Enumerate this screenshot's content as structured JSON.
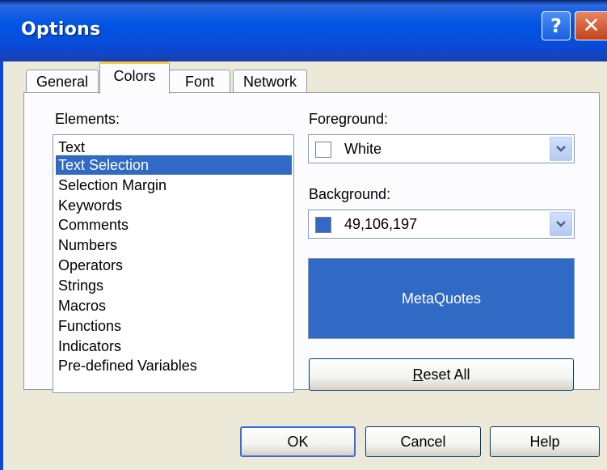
{
  "window": {
    "title": "Options"
  },
  "titlebar": {
    "help_glyph": "?",
    "close_glyph": "✕"
  },
  "tabs": [
    {
      "label": "General"
    },
    {
      "label": "Colors",
      "active": true
    },
    {
      "label": "Font"
    },
    {
      "label": "Network"
    }
  ],
  "elements": {
    "label": "Elements:",
    "items": [
      "Text",
      "Text Selection",
      "Selection Margin",
      "Keywords",
      "Comments",
      "Numbers",
      "Operators",
      "Strings",
      "Macros",
      "Functions",
      "Indicators",
      "Pre-defined Variables"
    ],
    "selected_index": 1
  },
  "foreground": {
    "label": "Foreground:",
    "value": "White",
    "color": "#ffffff"
  },
  "background": {
    "label": "Background:",
    "value": "49,106,197",
    "color": "#316ac5"
  },
  "preview": {
    "text": "MetaQuotes",
    "text_color": "#ffffff",
    "bg_color": "#316ac5"
  },
  "buttons": {
    "reset_first": "R",
    "reset_rest": "eset All",
    "ok": "OK",
    "cancel": "Cancel",
    "help": "Help"
  },
  "colors": {
    "selection": "#316ac5",
    "active_tab_accent": "#ffc83c"
  }
}
